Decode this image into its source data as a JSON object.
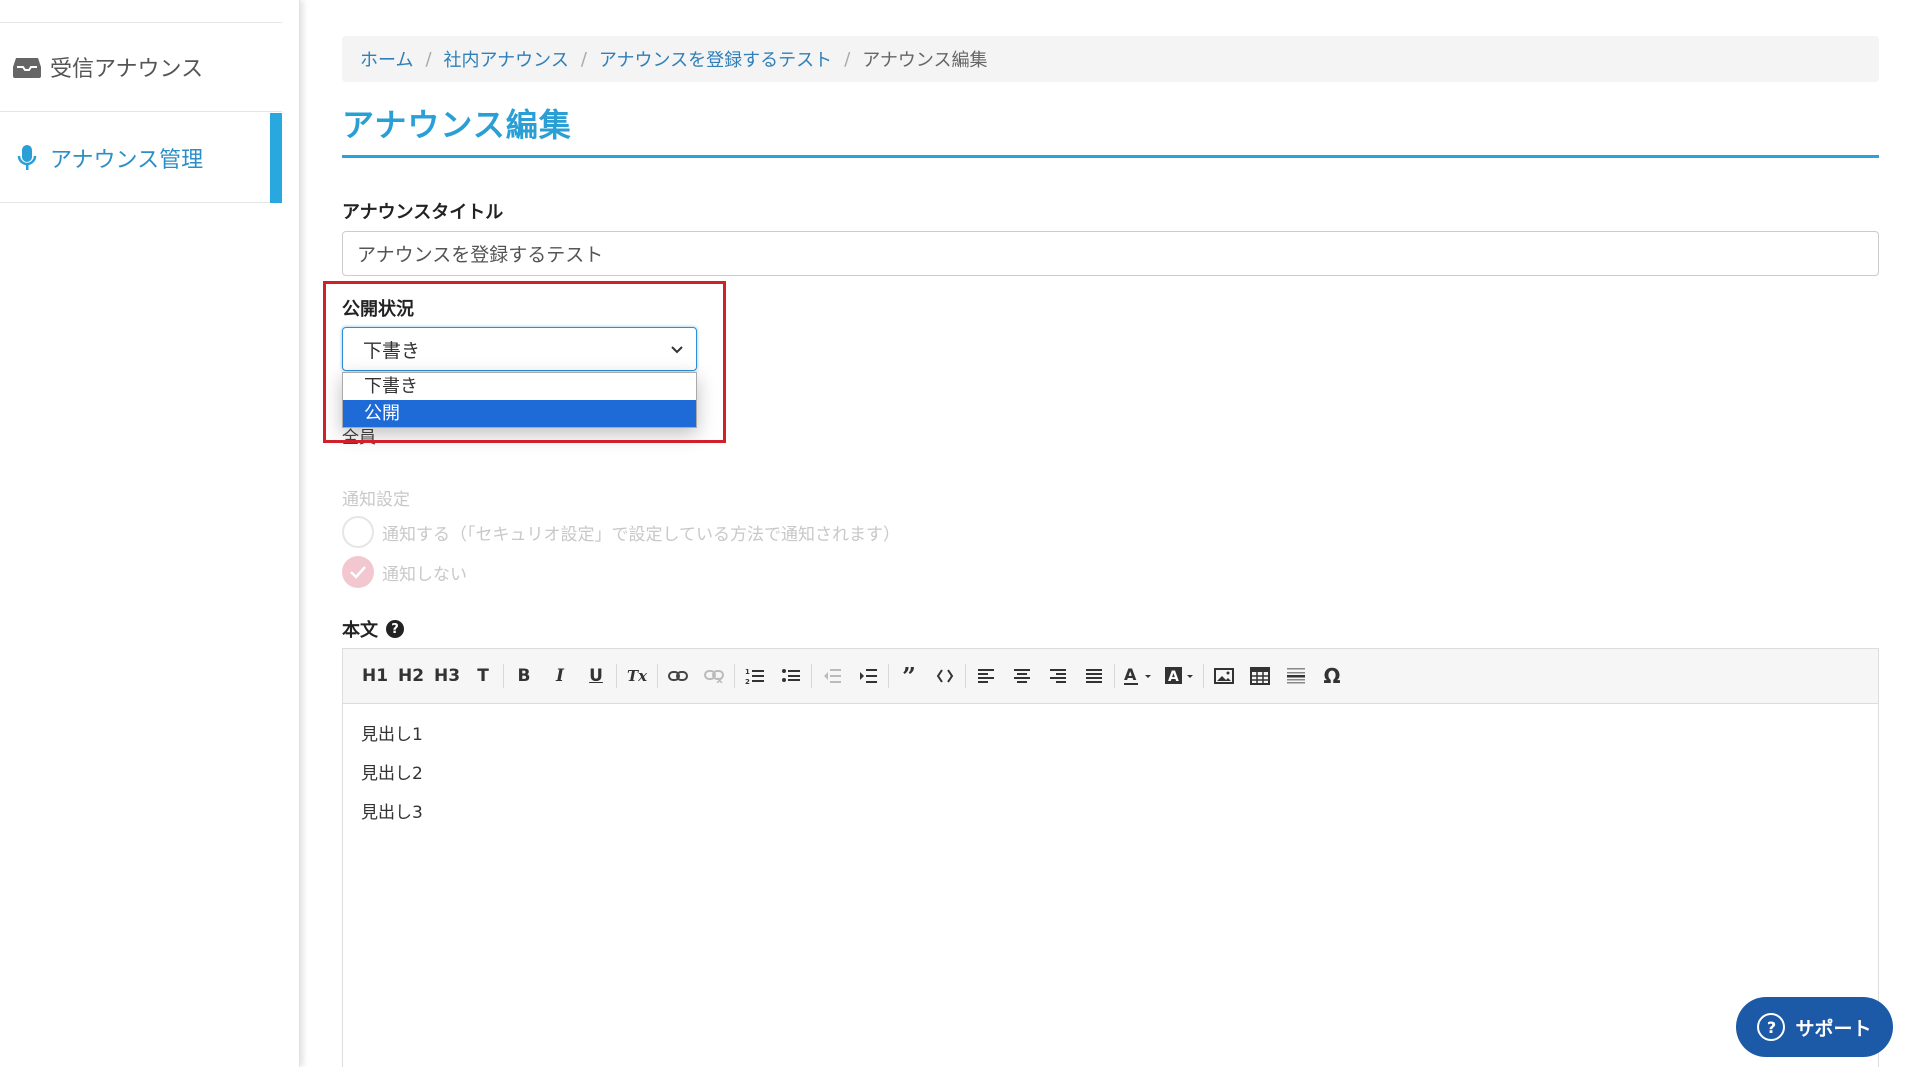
{
  "sidebar": {
    "items": [
      {
        "label": "受信アナウンス",
        "icon": "inbox-icon"
      },
      {
        "label": "アナウンス管理",
        "icon": "microphone-icon",
        "active": true
      }
    ]
  },
  "breadcrumb": {
    "items": [
      "ホーム",
      "社内アナウンス",
      "アナウンスを登録するテスト"
    ],
    "current": "アナウンス編集"
  },
  "page": {
    "title": "アナウンス編集"
  },
  "form": {
    "title_label": "アナウンスタイトル",
    "title_value": "アナウンスを登録するテスト",
    "status_label": "公開状況",
    "status_value": "下書き",
    "status_options": [
      "下書き",
      "公開"
    ],
    "status_highlighted_option": "公開",
    "under_text": "全員",
    "notify_label": "通知設定",
    "notify_options": [
      "通知する（「セキュリオ設定」で設定している方法で通知されます）",
      "通知しない"
    ],
    "body_label": "本文",
    "help_glyph": "?"
  },
  "toolbar": {
    "h1": "H1",
    "h2": "H2",
    "h3": "H3",
    "text": "T",
    "bold": "B",
    "italic": "I",
    "underline": "U",
    "clear": "Tx",
    "quote": "”"
  },
  "editor": {
    "lines": [
      "見出し1",
      "見出し2",
      "見出し3"
    ]
  },
  "support": {
    "label": "サポート",
    "glyph": "?"
  },
  "colors": {
    "accent": "#2aa2da",
    "highlight": "#d0202a",
    "selected": "#1e6ad6",
    "support": "#1c5aa8"
  }
}
